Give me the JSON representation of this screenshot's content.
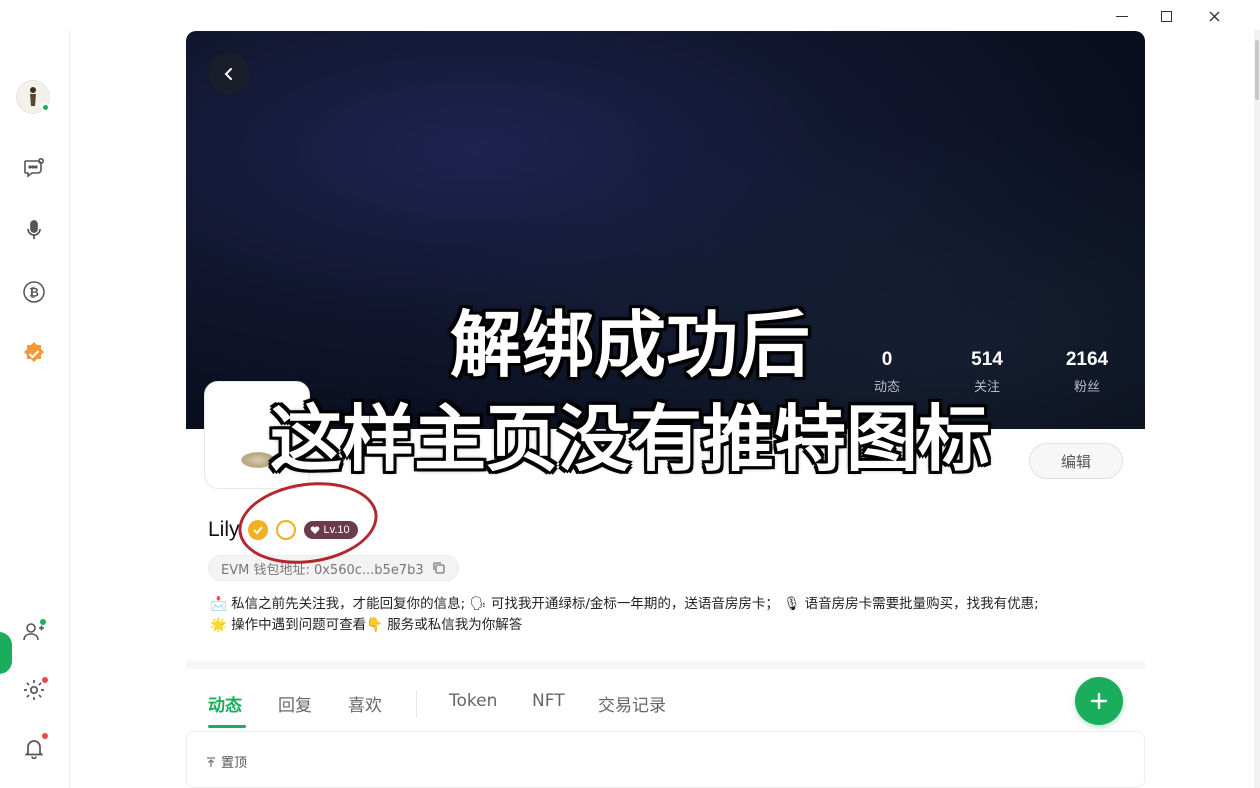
{
  "banner": {
    "stats": [
      {
        "value": "0",
        "label": "动态"
      },
      {
        "value": "514",
        "label": "关注"
      },
      {
        "value": "2164",
        "label": "粉丝"
      }
    ]
  },
  "profile": {
    "name": "Lily",
    "level": "Lv.10",
    "wallet": "EVM 钱包地址: 0x560c...b5e7b3",
    "edit_label": "编辑",
    "bio_line1": "📩 私信之前先关注我，才能回复你的信息; 🗣 可找我开通绿标/金标一年期的，送语音房房卡； 🎙 语音房房卡需要批量购买，找我有优惠;",
    "bio_line2": "🌟 操作中遇到问题可查看👇 服务或私信我为你解答"
  },
  "tabs": [
    {
      "label": "动态",
      "active": true
    },
    {
      "label": "回复",
      "active": false
    },
    {
      "label": "喜欢",
      "active": false
    },
    {
      "label": "Token",
      "active": false
    },
    {
      "label": "NFT",
      "active": false
    },
    {
      "label": "交易记录",
      "active": false
    }
  ],
  "pinned_label": "置顶",
  "caption": {
    "line1": "解绑成功后",
    "line2": "这样主页没有推特图标"
  },
  "colors": {
    "accent": "#1aad5b",
    "verified": "#f2b01e",
    "annotation": "#b3282f"
  }
}
